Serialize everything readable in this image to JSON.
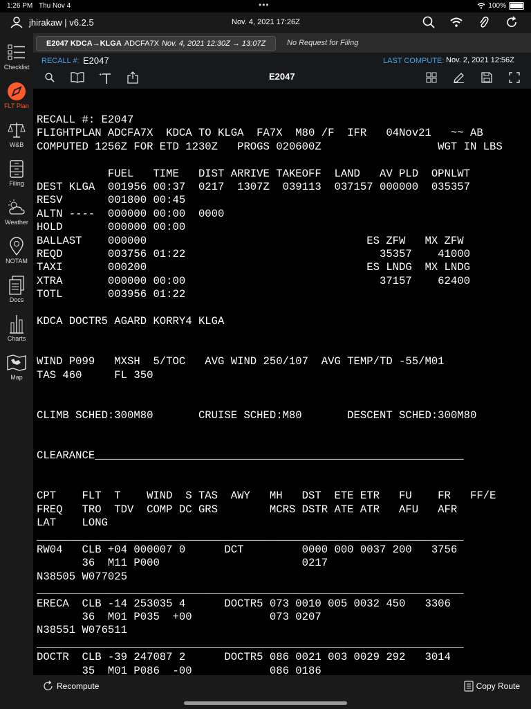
{
  "status_bar": {
    "time": "1:26 PM",
    "date": "Thu Nov 4",
    "battery": "100%",
    "battery_level": 1.0
  },
  "header": {
    "user": "jhirakaw | v6.2.5",
    "datetime": "Nov. 4, 2021  17:26Z",
    "icons": [
      "search-icon",
      "wifi-icon",
      "paperclip-icon",
      "refresh-icon"
    ]
  },
  "sidebar": {
    "items": [
      {
        "label": "Checklist",
        "icon": "checklist-icon"
      },
      {
        "label": "FLT Plan",
        "icon": "compass-icon",
        "active": true
      },
      {
        "label": "W&B",
        "icon": "scale-icon"
      },
      {
        "label": "Filing",
        "icon": "filing-icon"
      },
      {
        "label": "Weather",
        "icon": "weather-icon"
      },
      {
        "label": "NOTAM",
        "icon": "location-icon"
      },
      {
        "label": "Docs",
        "icon": "docs-icon"
      },
      {
        "label": "Charts",
        "icon": "chart-icon"
      },
      {
        "label": "Map",
        "icon": "map-icon"
      }
    ]
  },
  "tab": {
    "route": "E2047 KDCA→KLGA",
    "aircraft": "ADCFA7X",
    "time": "Nov. 4, 2021  12:30Z → 13:07Z",
    "request": "No Request for Filing"
  },
  "recall": {
    "label": "RECALL #:",
    "value": "E2047",
    "last_compute_label": "LAST COMPUTE:",
    "last_compute_value": "Nov. 2, 2021  12:56Z"
  },
  "toolbar": {
    "title": "E2047",
    "left_icons": [
      "search-icon",
      "book-icon",
      "text-size-icon",
      "share-icon"
    ],
    "right_icons": [
      "grid-icon",
      "pencil-icon",
      "save-icon",
      "expand-icon"
    ]
  },
  "flight_plan_text": "RECALL #: E2047\nFLIGHTPLAN ADCFA7X  KDCA TO KLGA  FA7X  M80 /F  IFR   04Nov21   ~~ AB\nCOMPUTED 1256Z FOR ETD 1230Z   PROGS 020600Z                  WGT IN LBS\n\n           FUEL   TIME   DIST ARRIVE TAKEOFF  LAND   AV PLD  OPNLWT\nDEST KLGA  001956 00:37  0217  1307Z  039113  037157 000000  035357\nRESV       001800 00:45\nALTN ----  000000 00:00  0000\nHOLD       000000 00:00\nBALLAST    000000                                  ES ZFW   MX ZFW\nREQD       003756 01:22                              35357    41000\nTAXI       000200                                  ES LNDG  MX LNDG\nXTRA       000000 00:00                              37157    62400\nTOTL       003956 01:22\n\nKDCA DOCTR5 AGARD KORRY4 KLGA\n\n\nWIND P099   MXSH  5/TOC   AVG WIND 250/107  AVG TEMP/TD -55/M01\nTAS 460     FL 350\n\n\nCLIMB SCHED:300M80       CRUISE SCHED:M80       DESCENT SCHED:300M80\n\n\nCLEARANCE_________________________________________________________\n\n\nCPT    FLT  T    WIND  S TAS  AWY   MH   DST  ETE ETR   FU    FR   FF/E\nFREQ   TRO  TDV  COMP DC GRS        MCRS DSTR ATE ATR   AFU   AFR\nLAT    LONG\n__________________________________________________________________\nRW04   CLB +04 000007 0      DCT         0000 000 0037 200   3756\n       36  M11 P000                      0217\nN38505 W077025\n__________________________________________________________________\nERECA  CLB -14 253035 4      DOCTR5 073 0010 005 0032 450   3306\n       36  M01 P035  +00            073 0207\nN38551 W076511\n__________________________________________________________________\nDOCTR  CLB -39 247087 2      DOCTR5 086 0021 003 0029 292   3014\n       35  M01 P086  -00            086 0186",
  "bottom": {
    "recompute": "Recompute",
    "copy_route": "Copy Route"
  },
  "colors": {
    "accent_blue": "#4aa3e8",
    "active_orange": "#ff5a2a"
  }
}
